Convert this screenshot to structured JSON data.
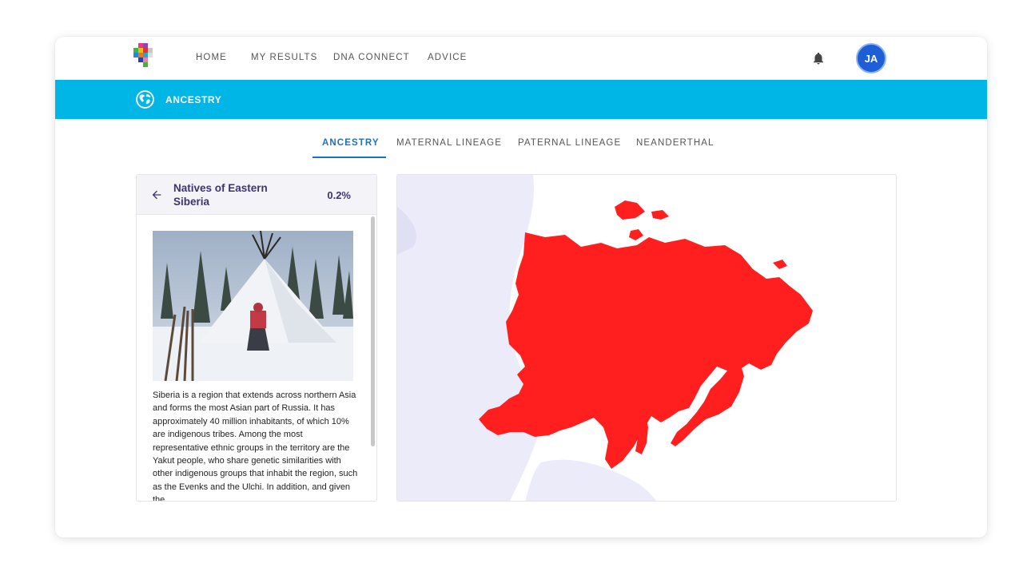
{
  "nav": {
    "items": [
      "HOME",
      "MY RESULTS",
      "DNA CONNECT",
      "ADVICE"
    ],
    "avatar_initials": "JA"
  },
  "banner": {
    "title": "ANCESTRY"
  },
  "tabs": [
    {
      "label": "ANCESTRY",
      "active": true
    },
    {
      "label": "MATERNAL LINEAGE",
      "active": false
    },
    {
      "label": "PATERNAL LINEAGE",
      "active": false
    },
    {
      "label": "NEANDERTHAL",
      "active": false
    }
  ],
  "region": {
    "title": "Natives of Eastern Siberia",
    "percentage": "0.2%",
    "description": "Siberia is a region that extends across northern Asia and forms the most Asian part of Russia. It has approximately 40 million inhabitants, of which 10% are indigenous tribes. Among the most representative ethnic groups in the territory are the Yakut people, who share genetic similarities with other indigenous groups that inhabit the region, such as the Evenks and the Ulchi. In addition, and given the"
  },
  "colors": {
    "accent": "#00b6e6",
    "tab_active": "#1e6fc7",
    "map_highlight": "#ff1f1f",
    "map_land": "#ebebfa",
    "heading": "#3d3470"
  },
  "icons": {
    "notifications": "bell-icon",
    "banner": "globe-icon",
    "back": "arrow-left-icon"
  }
}
